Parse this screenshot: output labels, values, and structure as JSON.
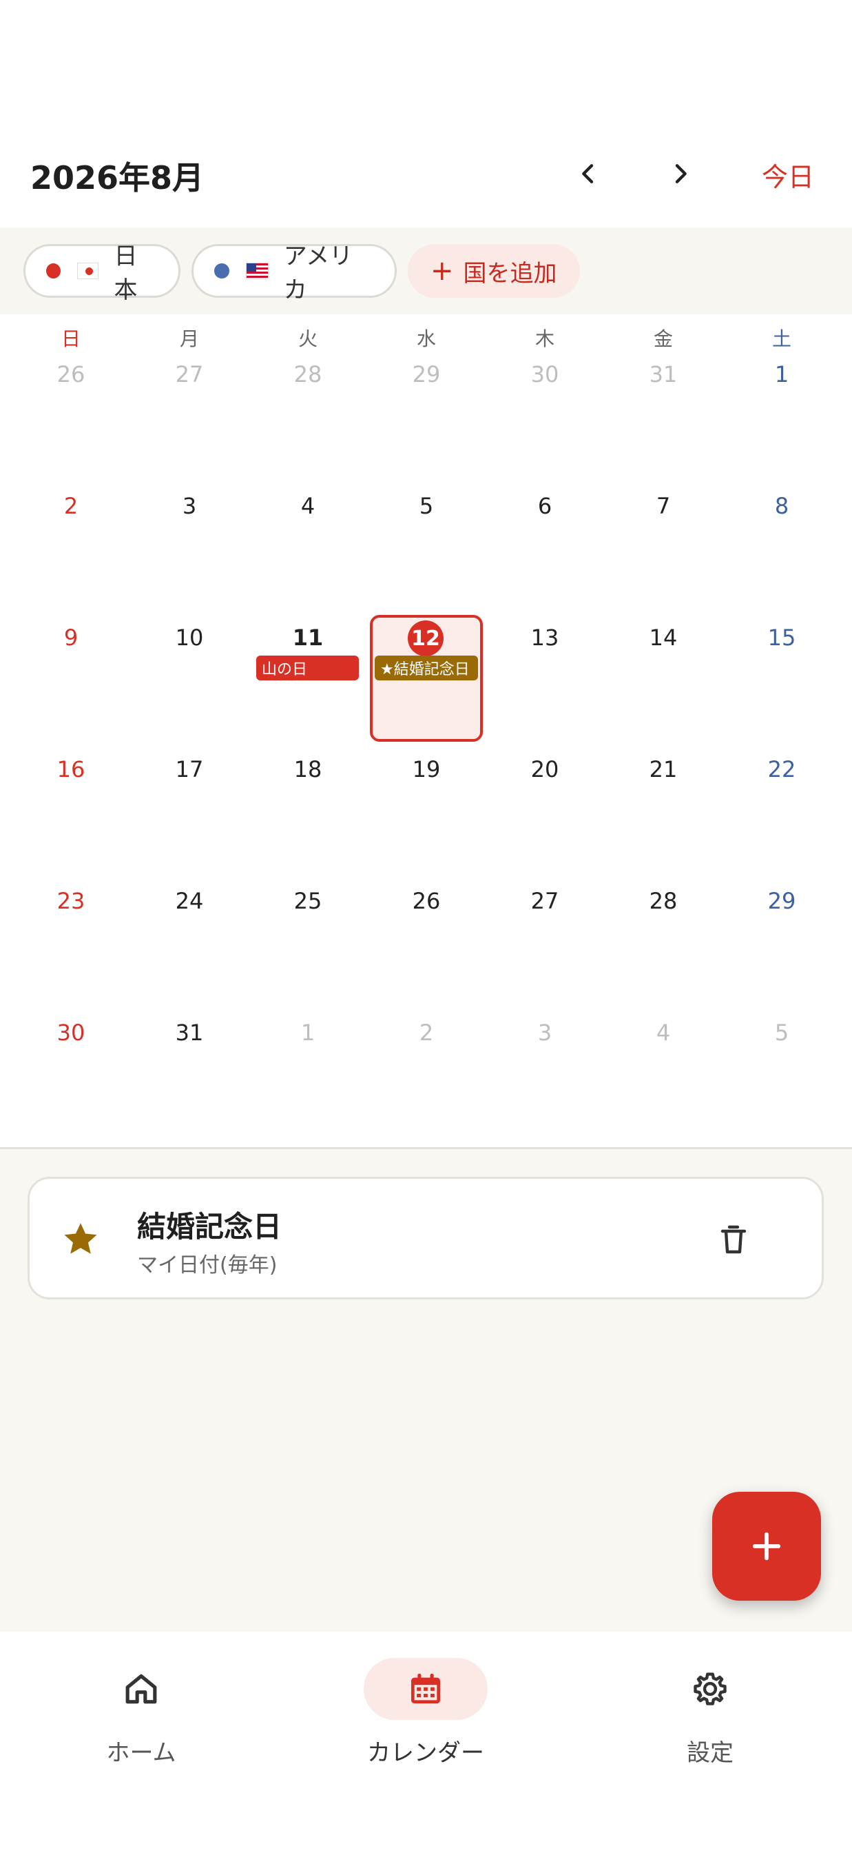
{
  "header": {
    "month_title": "2026年8月",
    "today_label": "今日"
  },
  "filters": {
    "chips": [
      {
        "label": "日本",
        "dot_color": "#d93025",
        "flag": "jp-flag-icon"
      },
      {
        "label": "アメリカ",
        "dot_color": "#4a6db0",
        "flag": "us-flag-icon"
      }
    ],
    "add_label": "国を追加"
  },
  "calendar": {
    "weekdays": [
      "日",
      "月",
      "火",
      "水",
      "木",
      "金",
      "土"
    ],
    "weeks": [
      [
        {
          "d": "26",
          "muted": true
        },
        {
          "d": "27",
          "muted": true
        },
        {
          "d": "28",
          "muted": true
        },
        {
          "d": "29",
          "muted": true
        },
        {
          "d": "30",
          "muted": true
        },
        {
          "d": "31",
          "muted": true
        },
        {
          "d": "1"
        }
      ],
      [
        {
          "d": "2"
        },
        {
          "d": "3"
        },
        {
          "d": "4"
        },
        {
          "d": "5"
        },
        {
          "d": "6"
        },
        {
          "d": "7"
        },
        {
          "d": "8"
        }
      ],
      [
        {
          "d": "9"
        },
        {
          "d": "10"
        },
        {
          "d": "11",
          "bold": true
        },
        {
          "d": "12",
          "selected": true
        },
        {
          "d": "13"
        },
        {
          "d": "14"
        },
        {
          "d": "15"
        }
      ],
      [
        {
          "d": "16"
        },
        {
          "d": "17"
        },
        {
          "d": "18"
        },
        {
          "d": "19"
        },
        {
          "d": "20"
        },
        {
          "d": "21"
        },
        {
          "d": "22"
        }
      ],
      [
        {
          "d": "23"
        },
        {
          "d": "24"
        },
        {
          "d": "25"
        },
        {
          "d": "26"
        },
        {
          "d": "27"
        },
        {
          "d": "28"
        },
        {
          "d": "29"
        }
      ],
      [
        {
          "d": "30"
        },
        {
          "d": "31"
        },
        {
          "d": "1",
          "muted": true
        },
        {
          "d": "2",
          "muted": true
        },
        {
          "d": "3",
          "muted": true
        },
        {
          "d": "4",
          "muted": true
        },
        {
          "d": "5",
          "muted": true
        }
      ]
    ],
    "selected_day": "12",
    "events": {
      "holiday_label": "山の日",
      "anniversary_label": "★結婚記念日"
    }
  },
  "event_card": {
    "title": "結婚記念日",
    "subtitle": "マイ日付(毎年)"
  },
  "bottom_nav": {
    "home_label": "ホーム",
    "calendar_label": "カレンダー",
    "settings_label": "設定"
  },
  "colors": {
    "accent": "#d93025",
    "saturday": "#3d5fa3",
    "anniversary": "#9a6a07"
  }
}
